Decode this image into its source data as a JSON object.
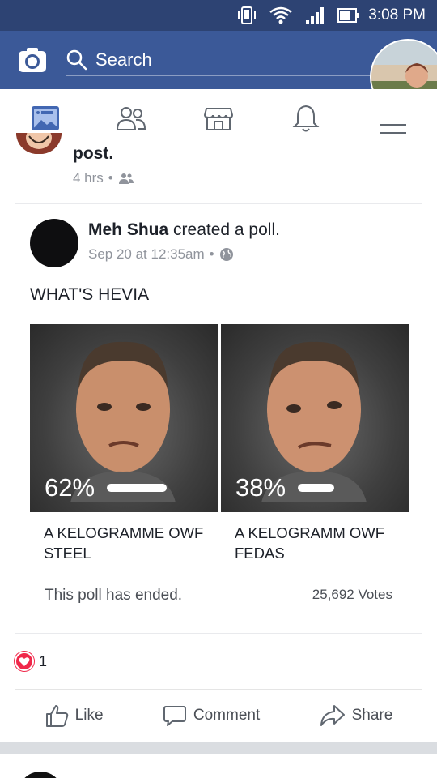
{
  "status_bar": {
    "time": "3:08 PM",
    "icons": [
      "vibrate-icon",
      "wifi-icon",
      "signal-icon",
      "battery-icon"
    ]
  },
  "app_bar": {
    "search_placeholder": "Search",
    "camera_icon": "camera-icon",
    "color": "#3b5998"
  },
  "nav_tabs": [
    {
      "name": "news-feed",
      "icon": "news-feed-icon",
      "active": true
    },
    {
      "name": "friends",
      "icon": "friends-icon",
      "active": false
    },
    {
      "name": "marketplace",
      "icon": "marketplace-icon",
      "active": false
    },
    {
      "name": "notifications",
      "icon": "bell-icon",
      "active": false
    },
    {
      "name": "menu",
      "icon": "menu-icon",
      "active": false
    }
  ],
  "previous_post": {
    "text": "post.",
    "time": "4 hrs",
    "audience": "friends-icon"
  },
  "poll_post": {
    "author": "Meh Shua",
    "action": " created a poll.",
    "date": "Sep 20 at 12:35am",
    "audience": "globe-icon",
    "question": "WHAT'S HEVIA",
    "options": [
      {
        "percent": "62%",
        "value": 62,
        "label": "A KELOGRAMME OWF STEEL"
      },
      {
        "percent": "38%",
        "value": 38,
        "label": "A KELOGRAMM OWF FEDAS"
      }
    ],
    "status": "This poll has ended.",
    "votes": "25,692 Votes"
  },
  "reactions": {
    "count": "1",
    "icon": "heart-icon",
    "color": "#f0284a"
  },
  "actions": {
    "like": "Like",
    "comment": "Comment",
    "share": "Share"
  }
}
